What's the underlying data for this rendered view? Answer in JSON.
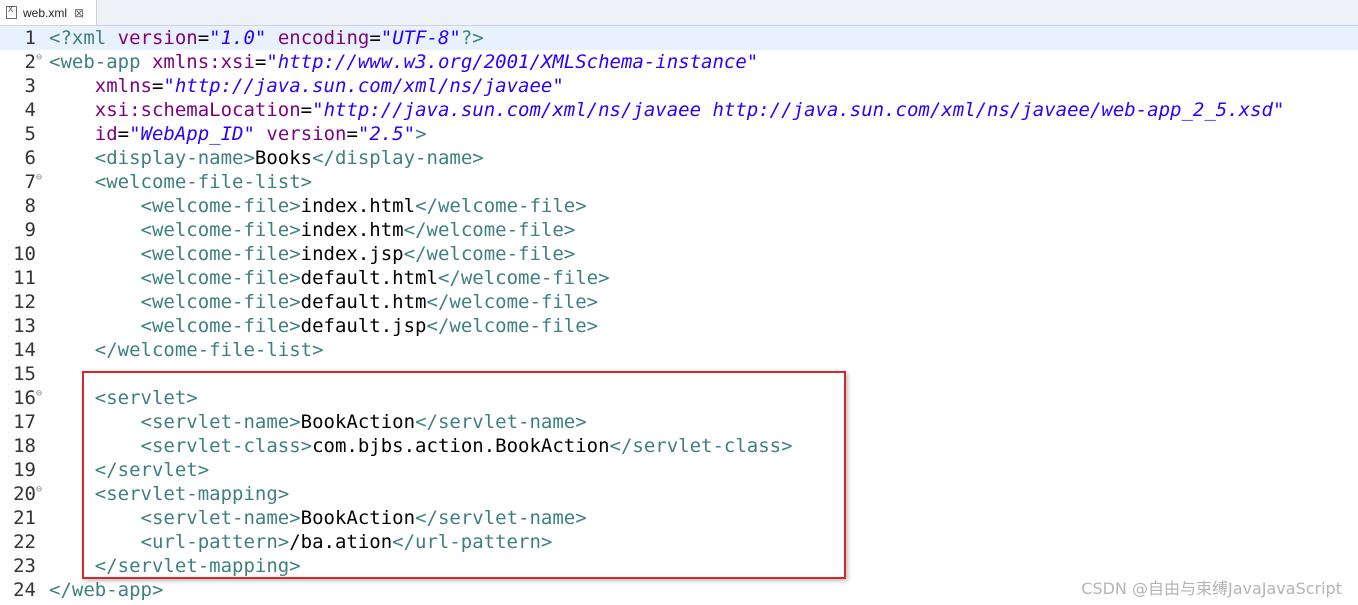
{
  "tab": {
    "filename": "web.xml",
    "close": "⊠"
  },
  "lines": [
    {
      "n": "1",
      "segs": [
        [
          "t",
          "<?xml "
        ],
        [
          "a",
          "version"
        ],
        [
          "x",
          "="
        ],
        [
          "v",
          "\"1.0\""
        ],
        [
          "a",
          " encoding"
        ],
        [
          "x",
          "="
        ],
        [
          "v",
          "\"UTF-8\""
        ],
        [
          "t",
          "?>"
        ]
      ]
    },
    {
      "n": "2",
      "fold": true,
      "segs": [
        [
          "t",
          "<web-app "
        ],
        [
          "a",
          "xmlns:xsi"
        ],
        [
          "x",
          "="
        ],
        [
          "v",
          "\"http://www.w3.org/2001/XMLSchema-instance\""
        ]
      ]
    },
    {
      "n": "3",
      "segs": [
        [
          "a",
          "    xmlns"
        ],
        [
          "x",
          "="
        ],
        [
          "v",
          "\"http://java.sun.com/xml/ns/javaee\""
        ]
      ]
    },
    {
      "n": "4",
      "segs": [
        [
          "a",
          "    xsi:schemaLocation"
        ],
        [
          "x",
          "="
        ],
        [
          "v",
          "\"http://java.sun.com/xml/ns/javaee http://java.sun.com/xml/ns/javaee/web-app_2_5.xsd\""
        ]
      ]
    },
    {
      "n": "5",
      "segs": [
        [
          "a",
          "    id"
        ],
        [
          "x",
          "="
        ],
        [
          "v",
          "\"WebApp_ID\""
        ],
        [
          "a",
          " version"
        ],
        [
          "x",
          "="
        ],
        [
          "v",
          "\"2.5\""
        ],
        [
          "t",
          ">"
        ]
      ]
    },
    {
      "n": "6",
      "segs": [
        [
          "t",
          "    <display-name>"
        ],
        [
          "x",
          "Books"
        ],
        [
          "t",
          "</display-name>"
        ]
      ]
    },
    {
      "n": "7",
      "fold": true,
      "segs": [
        [
          "t",
          "    <welcome-file-list>"
        ]
      ]
    },
    {
      "n": "8",
      "segs": [
        [
          "t",
          "        <welcome-file>"
        ],
        [
          "x",
          "index.html"
        ],
        [
          "t",
          "</welcome-file>"
        ]
      ]
    },
    {
      "n": "9",
      "segs": [
        [
          "t",
          "        <welcome-file>"
        ],
        [
          "x",
          "index.htm"
        ],
        [
          "t",
          "</welcome-file>"
        ]
      ]
    },
    {
      "n": "10",
      "segs": [
        [
          "t",
          "        <welcome-file>"
        ],
        [
          "x",
          "index.jsp"
        ],
        [
          "t",
          "</welcome-file>"
        ]
      ]
    },
    {
      "n": "11",
      "segs": [
        [
          "t",
          "        <welcome-file>"
        ],
        [
          "x",
          "default.html"
        ],
        [
          "t",
          "</welcome-file>"
        ]
      ]
    },
    {
      "n": "12",
      "segs": [
        [
          "t",
          "        <welcome-file>"
        ],
        [
          "x",
          "default.htm"
        ],
        [
          "t",
          "</welcome-file>"
        ]
      ]
    },
    {
      "n": "13",
      "segs": [
        [
          "t",
          "        <welcome-file>"
        ],
        [
          "x",
          "default.jsp"
        ],
        [
          "t",
          "</welcome-file>"
        ]
      ]
    },
    {
      "n": "14",
      "segs": [
        [
          "t",
          "    </welcome-file-list>"
        ]
      ]
    },
    {
      "n": "15",
      "segs": []
    },
    {
      "n": "16",
      "fold": true,
      "segs": [
        [
          "t",
          "    <servlet>"
        ]
      ]
    },
    {
      "n": "17",
      "segs": [
        [
          "t",
          "        <servlet-name>"
        ],
        [
          "x",
          "BookAction"
        ],
        [
          "t",
          "</servlet-name>"
        ]
      ]
    },
    {
      "n": "18",
      "segs": [
        [
          "t",
          "        <servlet-class>"
        ],
        [
          "x",
          "com.bjbs.action.BookAction"
        ],
        [
          "t",
          "</servlet-class>"
        ]
      ]
    },
    {
      "n": "19",
      "segs": [
        [
          "t",
          "    </servlet>"
        ]
      ]
    },
    {
      "n": "20",
      "fold": true,
      "segs": [
        [
          "t",
          "    <servlet-mapping>"
        ]
      ]
    },
    {
      "n": "21",
      "segs": [
        [
          "t",
          "        <servlet-name>"
        ],
        [
          "x",
          "BookAction"
        ],
        [
          "t",
          "</servlet-name>"
        ]
      ]
    },
    {
      "n": "22",
      "segs": [
        [
          "t",
          "        <url-pattern>"
        ],
        [
          "x",
          "/ba.ation"
        ],
        [
          "t",
          "</url-pattern>"
        ]
      ]
    },
    {
      "n": "23",
      "segs": [
        [
          "t",
          "    </servlet-mapping>"
        ]
      ]
    },
    {
      "n": "24",
      "segs": [
        [
          "t",
          "</web-app>"
        ]
      ]
    }
  ],
  "current_line": "1",
  "fold_glyph": "⊖",
  "watermark": "CSDN @自由与束缚JavaJavaScript",
  "colors": {
    "tag": "#3f7f7f",
    "attr": "#7f007f",
    "value": "#2a00ff",
    "highlight_box": "#d9262a",
    "current_line": "#e8f2fe"
  }
}
